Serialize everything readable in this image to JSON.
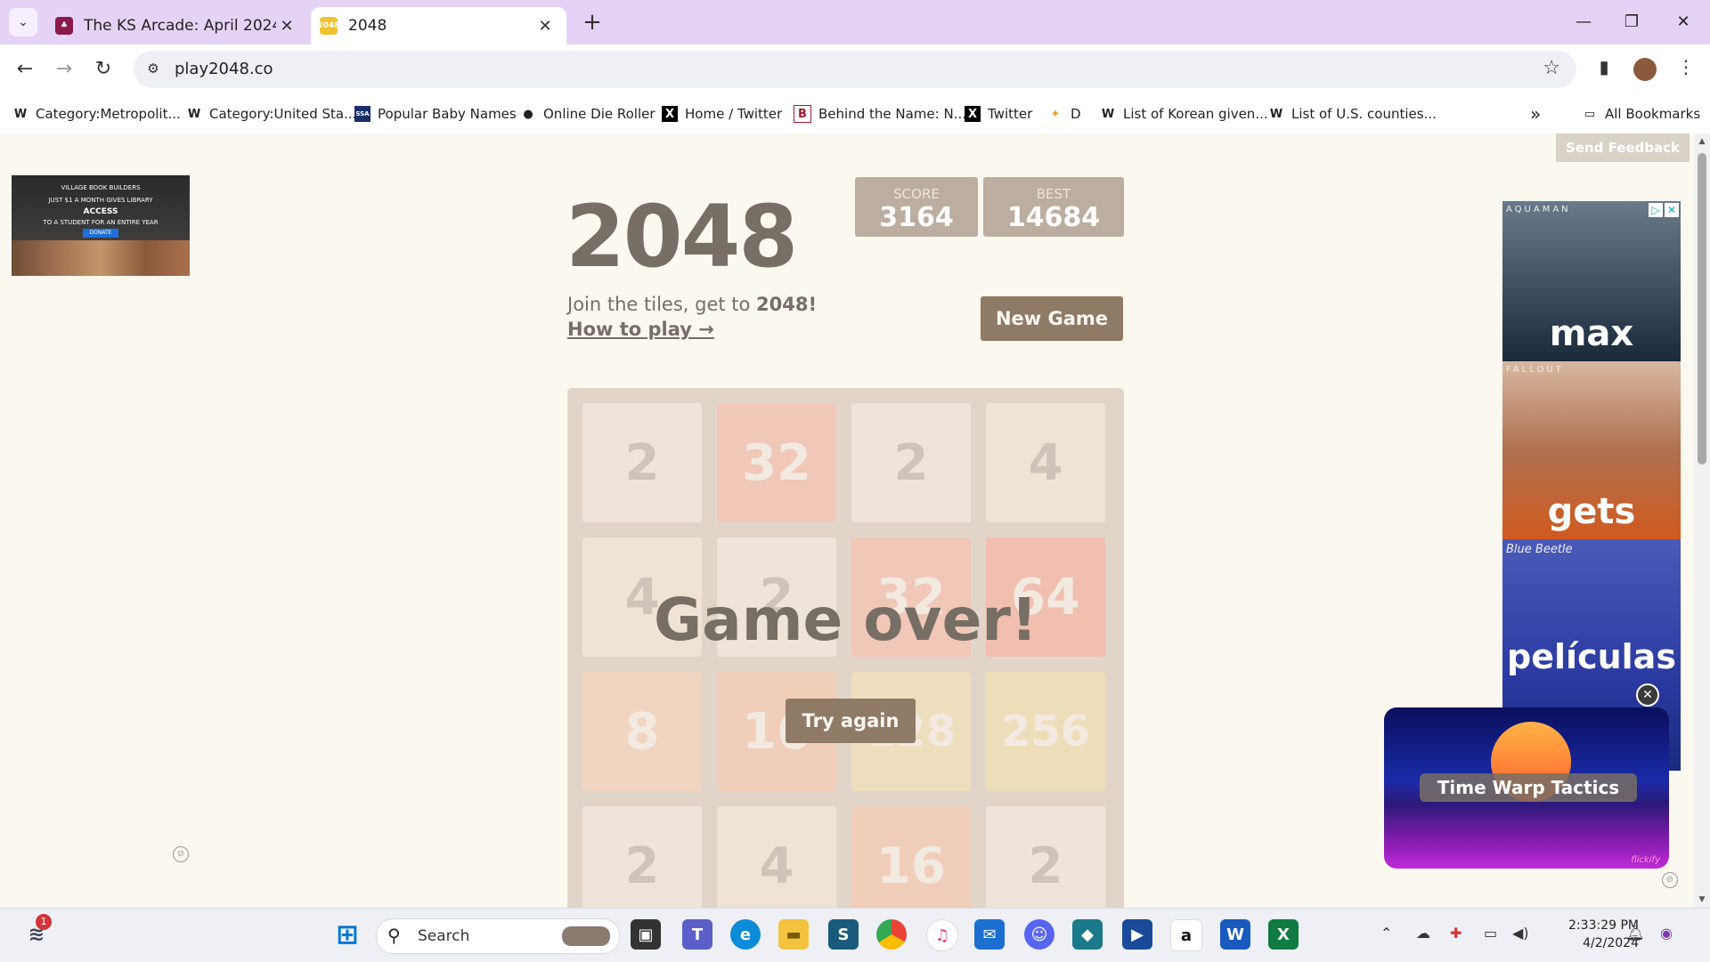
{
  "browser": {
    "tabs": [
      {
        "title": "The KS Arcade: April 2024 [Solo",
        "active": false
      },
      {
        "title": "2048",
        "active": true
      }
    ],
    "url": "play2048.co",
    "bookmarks": [
      {
        "label": "Category:Metropolit...",
        "icon": "W"
      },
      {
        "label": "Category:United Sta...",
        "icon": "W"
      },
      {
        "label": "Popular Baby Names",
        "icon": "SSA"
      },
      {
        "label": "Online Die Roller",
        "icon": "●"
      },
      {
        "label": "Home / Twitter",
        "icon": "X"
      },
      {
        "label": "Behind the Name: N...",
        "icon": "B"
      },
      {
        "label": "Twitter",
        "icon": "X"
      },
      {
        "label": "D",
        "icon": "✦"
      },
      {
        "label": "List of Korean given...",
        "icon": "W"
      },
      {
        "label": "List of U.S. counties...",
        "icon": "W"
      }
    ],
    "all_bookmarks": "All Bookmarks",
    "overflow": "»"
  },
  "page": {
    "send_feedback": "Send Feedback",
    "left_ad": {
      "org": "VILLAGE BOOK BUILDERS",
      "line1": "JUST $1 A MONTH GIVES LIBRARY",
      "line2": "ACCESS",
      "line3": "TO A STUDENT FOR AN ENTIRE YEAR",
      "button": "DONATE"
    },
    "game": {
      "title": "2048",
      "score_label": "SCORE",
      "score": "3164",
      "best_label": "BEST",
      "best": "14684",
      "intro_prefix": "Join the tiles, get to ",
      "intro_target": "2048!",
      "how_to_play": "How to play →",
      "new_game": "New Game",
      "game_over": "Game over!",
      "try_again": "Try again",
      "grid": [
        [
          "2",
          "32",
          "2",
          "4"
        ],
        [
          "4",
          "2",
          "32",
          "64"
        ],
        [
          "8",
          "16",
          "128",
          "256"
        ],
        [
          "2",
          "4",
          "16",
          "2"
        ]
      ],
      "tile_colors": {
        "2": "#eee4da",
        "4": "#ede0c8",
        "8": "#f2b179",
        "16": "#f59563",
        "32": "#f67c5f",
        "64": "#f65e3b",
        "128": "#edcf72",
        "256": "#edcc61"
      }
    },
    "right_ad": {
      "panels": [
        {
          "small": "AQUAMAN",
          "big": "max",
          "color": "#3a4a5a"
        },
        {
          "small": "FALLOUT",
          "big": "gets",
          "color": "#c0501e"
        },
        {
          "small": "Blue Beetle",
          "big": "películas",
          "color": "#2a3aa0"
        }
      ]
    },
    "video_ad": {
      "title": "Time Warp Tactics",
      "brand": "flickify"
    }
  },
  "taskbar": {
    "search_placeholder": "Search",
    "notification_count": "1",
    "time": "2:33:29 PM",
    "date": "4/2/2024",
    "apps": [
      "windows-start",
      "task-view",
      "teams",
      "edge",
      "file-explorer",
      "app-s",
      "chrome",
      "itunes",
      "mail",
      "discord",
      "app-cat",
      "video-player",
      "amazon",
      "word",
      "excel"
    ]
  }
}
